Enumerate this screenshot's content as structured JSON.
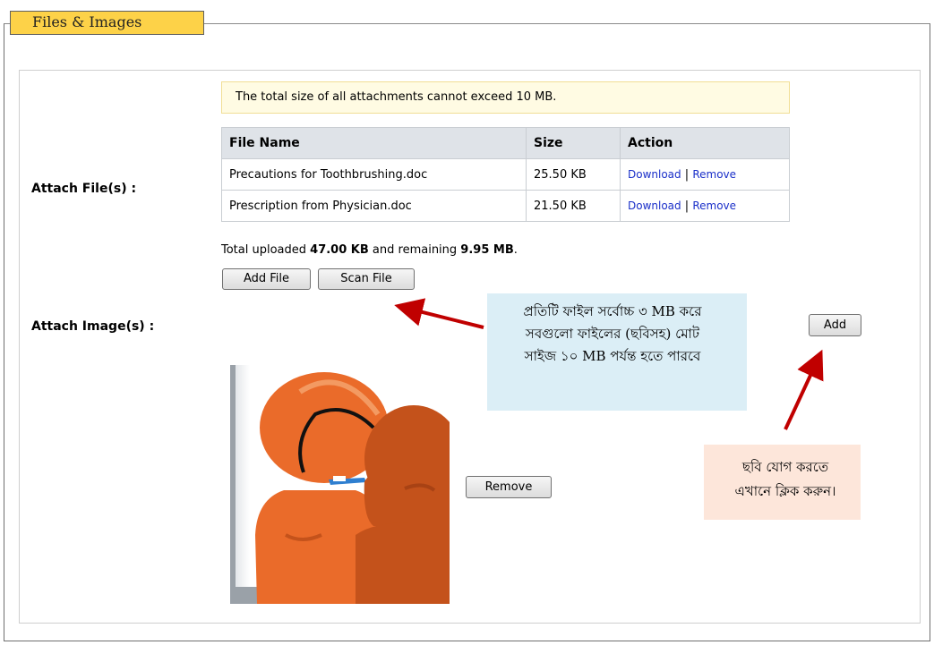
{
  "section": {
    "title": "Files & Images"
  },
  "attach_files": {
    "label": "Attach File(s) :",
    "notice": "The total size of all attachments cannot exceed 10 MB.",
    "columns": [
      "File Name",
      "Size",
      "Action"
    ],
    "rows": [
      {
        "name": "Precautions for Toothbrushing.doc",
        "size": "25.50 KB",
        "download": "Download",
        "sep": "|",
        "remove": "Remove"
      },
      {
        "name": "Prescription from Physician.doc",
        "size": "21.50 KB",
        "download": "Download",
        "sep": "|",
        "remove": "Remove"
      }
    ],
    "total_prefix": "Total uploaded ",
    "total_uploaded": "47.00 KB",
    "total_middle": " and remaining ",
    "total_remaining": "9.95 MB",
    "total_suffix": ".",
    "add_file_label": "Add File",
    "scan_file_label": "Scan File"
  },
  "attach_images": {
    "label": "Attach Image(s) :",
    "add_label": "Add",
    "remove_label": "Remove"
  },
  "callouts": {
    "file_limit": [
      "প্রতিটি  ফাইল সর্বোচ্চ    ৩ MB করে",
      "সবগুলো ফাইলের (ছবিসহ) মোট",
      "সাইজ ১০ MB পর্যন্ত     হতে পারবে"
    ],
    "add_image": [
      "ছবি যোগ করতে",
      "এখানে ক্লিক করুন।"
    ]
  },
  "colors": {
    "tab": "#fdd248",
    "header_bg": "#dfe3e8",
    "link": "#1a2fc9",
    "callout_blue": "#dbeef6",
    "callout_pink": "#fde6da",
    "arrow": "#c00000",
    "figure_orange": "#ea6b2a"
  }
}
